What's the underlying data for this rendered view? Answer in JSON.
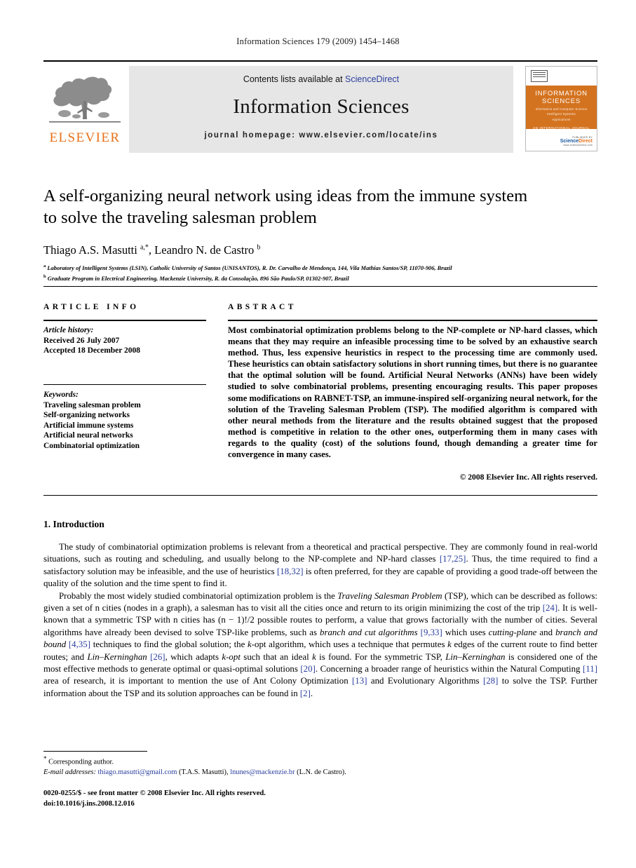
{
  "running_head": "Information Sciences 179 (2009) 1454–1468",
  "masthead": {
    "contents_prefix": "Contents lists available at",
    "sciencedirect_link": "ScienceDirect",
    "journal_title": "Information Sciences",
    "homepage": "journal homepage: www.elsevier.com/locate/ins",
    "elsevier_wordmark": "ELSEVIER",
    "cover": {
      "line1": "INFORMATION",
      "line2": "SCIENCES",
      "line3": "Informatics and Computer Science",
      "line4": "Intelligent Systems",
      "line5": "Applications",
      "line6": "AN INTERNATIONAL JOURNAL",
      "publisher_label": "PUBLISHED BY",
      "brand_sci": "Science",
      "brand_dir": "Direct",
      "brand_sub": "www.sciencedirect.com"
    }
  },
  "article": {
    "title_line1": "A self-organizing neural network using ideas from the immune system",
    "title_line2": "to solve the traveling salesman problem",
    "authors_html": "Thiago A.S. Masutti <sup>a,*</sup>, Leandro N. de Castro <sup>b</sup>",
    "affiliation_a": "Laboratory of Intelligent Systems (LSIN), Catholic University of Santos (UNISANTOS), R. Dr. Carvalho de Mendonça, 144, Vila Mathias Santos/SP, 11070-906, Brazil",
    "affiliation_b": "Graduate Program in Electrical Engineering, Mackenzie University, R. da Consolação, 896 São Paulo/SP, 01302-907, Brazil"
  },
  "info": {
    "heading": "ARTICLE INFO",
    "history_label": "Article history:",
    "received": "Received 26 July 2007",
    "accepted": "Accepted 18 December 2008",
    "keywords_label": "Keywords:",
    "keywords": [
      "Traveling salesman problem",
      "Self-organizing networks",
      "Artificial immune systems",
      "Artificial neural networks",
      "Combinatorial optimization"
    ]
  },
  "abstract": {
    "heading": "ABSTRACT",
    "text": "Most combinatorial optimization problems belong to the NP-complete or NP-hard classes, which means that they may require an infeasible processing time to be solved by an exhaustive search method. Thus, less expensive heuristics in respect to the processing time are commonly used. These heuristics can obtain satisfactory solutions in short running times, but there is no guarantee that the optimal solution will be found. Artificial Neural Networks (ANNs) have been widely studied to solve combinatorial problems, presenting encouraging results. This paper proposes some modifications on RABNET-TSP, an immune-inspired self-organizing neural network, for the solution of the Traveling Salesman Problem (TSP). The modified algorithm is compared with other neural methods from the literature and the results obtained suggest that the proposed method is competitive in relation to the other ones, outperforming them in many cases with regards to the quality (cost) of the solutions found, though demanding a greater time for convergence in many cases.",
    "copyright": "© 2008 Elsevier Inc. All rights reserved."
  },
  "body": {
    "section_heading": "1. Introduction",
    "paragraph1_html": "The study of combinatorial optimization problems is relevant from a theoretical and practical perspective. They are commonly found in real-world situations, such as routing and scheduling, and usually belong to the NP-complete and NP-hard classes <span class=\"cit\">[17,25]</span>. Thus, the time required to find a satisfactory solution may be infeasible, and the use of heuristics <span class=\"cit\">[18,32]</span> is often preferred, for they are capable of providing a good trade-off between the quality of the solution and the time spent to find it.",
    "paragraph2_html": "Probably the most widely studied combinatorial optimization problem is the <span class=\"it\">Traveling Salesman Problem</span> (TSP), which can be described as follows: given a set of n cities (nodes in a graph), a salesman has to visit all the cities once and return to its origin minimizing the cost of the trip <span class=\"cit\">[24]</span>. It is well-known that a symmetric TSP with n cities has (n − 1)!/2 possible routes to perform, a value that grows factorially with the number of cities. Several algorithms have already been devised to solve TSP-like problems, such as <span class=\"it\">branch and cut algorithms</span> <span class=\"cit\">[9,33]</span> which uses <span class=\"it\">cutting-plane</span> and <span class=\"it\">branch and bound</span> <span class=\"cit\">[4,35]</span> techniques to find the global solution; the <span class=\"it\">k</span>-opt algorithm, which uses a technique that permutes <span class=\"it\">k</span> edges of the current route to find better routes; and <span class=\"it\">Lin–Kerninghan</span> <span class=\"cit\">[26]</span>, which adapts <span class=\"it\">k-opt</span> such that an ideal <span class=\"it\">k</span> is found. For the symmetric TSP, <span class=\"it\">Lin–Kerninghan</span> is considered one of the most effective methods to generate optimal or quasi-optimal solutions <span class=\"cit\">[20]</span>. Concerning a broader range of heuristics within the Natural Computing <span class=\"cit\">[11]</span> area of research, it is important to mention the use of Ant Colony Optimization <span class=\"cit\">[13]</span> and Evolutionary Algorithms <span class=\"cit\">[28]</span> to solve the TSP. Further information about the TSP and its solution approaches can be found in <span class=\"cit\">[2]</span>."
  },
  "footer": {
    "corresponding_author": "Corresponding author.",
    "email_label": "E-mail addresses:",
    "email1": "thiago.masutti@gmail.com",
    "email1_owner": "(T.A.S. Masutti),",
    "email2": "lnunes@mackenzie.br",
    "email2_owner": "(L.N. de Castro).",
    "issn_line": "0020-0255/$ - see front matter © 2008 Elsevier Inc. All rights reserved.",
    "doi_line": "doi:10.1016/j.ins.2008.12.016"
  },
  "colors": {
    "link_blue": "#2b3f9e",
    "elsevier_orange": "#e8711a",
    "banner_gray": "#e6e6e6",
    "cover_orange": "#d4731f"
  }
}
